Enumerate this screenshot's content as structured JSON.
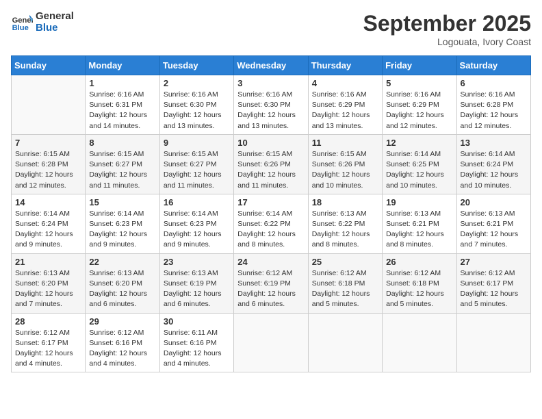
{
  "logo": {
    "line1": "General",
    "line2": "Blue"
  },
  "title": "September 2025",
  "location": "Logouata, Ivory Coast",
  "days_header": [
    "Sunday",
    "Monday",
    "Tuesday",
    "Wednesday",
    "Thursday",
    "Friday",
    "Saturday"
  ],
  "weeks": [
    [
      {
        "day": "",
        "info": ""
      },
      {
        "day": "1",
        "info": "Sunrise: 6:16 AM\nSunset: 6:31 PM\nDaylight: 12 hours\nand 14 minutes."
      },
      {
        "day": "2",
        "info": "Sunrise: 6:16 AM\nSunset: 6:30 PM\nDaylight: 12 hours\nand 13 minutes."
      },
      {
        "day": "3",
        "info": "Sunrise: 6:16 AM\nSunset: 6:30 PM\nDaylight: 12 hours\nand 13 minutes."
      },
      {
        "day": "4",
        "info": "Sunrise: 6:16 AM\nSunset: 6:29 PM\nDaylight: 12 hours\nand 13 minutes."
      },
      {
        "day": "5",
        "info": "Sunrise: 6:16 AM\nSunset: 6:29 PM\nDaylight: 12 hours\nand 12 minutes."
      },
      {
        "day": "6",
        "info": "Sunrise: 6:16 AM\nSunset: 6:28 PM\nDaylight: 12 hours\nand 12 minutes."
      }
    ],
    [
      {
        "day": "7",
        "info": "Sunrise: 6:15 AM\nSunset: 6:28 PM\nDaylight: 12 hours\nand 12 minutes."
      },
      {
        "day": "8",
        "info": "Sunrise: 6:15 AM\nSunset: 6:27 PM\nDaylight: 12 hours\nand 11 minutes."
      },
      {
        "day": "9",
        "info": "Sunrise: 6:15 AM\nSunset: 6:27 PM\nDaylight: 12 hours\nand 11 minutes."
      },
      {
        "day": "10",
        "info": "Sunrise: 6:15 AM\nSunset: 6:26 PM\nDaylight: 12 hours\nand 11 minutes."
      },
      {
        "day": "11",
        "info": "Sunrise: 6:15 AM\nSunset: 6:26 PM\nDaylight: 12 hours\nand 10 minutes."
      },
      {
        "day": "12",
        "info": "Sunrise: 6:14 AM\nSunset: 6:25 PM\nDaylight: 12 hours\nand 10 minutes."
      },
      {
        "day": "13",
        "info": "Sunrise: 6:14 AM\nSunset: 6:24 PM\nDaylight: 12 hours\nand 10 minutes."
      }
    ],
    [
      {
        "day": "14",
        "info": "Sunrise: 6:14 AM\nSunset: 6:24 PM\nDaylight: 12 hours\nand 9 minutes."
      },
      {
        "day": "15",
        "info": "Sunrise: 6:14 AM\nSunset: 6:23 PM\nDaylight: 12 hours\nand 9 minutes."
      },
      {
        "day": "16",
        "info": "Sunrise: 6:14 AM\nSunset: 6:23 PM\nDaylight: 12 hours\nand 9 minutes."
      },
      {
        "day": "17",
        "info": "Sunrise: 6:14 AM\nSunset: 6:22 PM\nDaylight: 12 hours\nand 8 minutes."
      },
      {
        "day": "18",
        "info": "Sunrise: 6:13 AM\nSunset: 6:22 PM\nDaylight: 12 hours\nand 8 minutes."
      },
      {
        "day": "19",
        "info": "Sunrise: 6:13 AM\nSunset: 6:21 PM\nDaylight: 12 hours\nand 8 minutes."
      },
      {
        "day": "20",
        "info": "Sunrise: 6:13 AM\nSunset: 6:21 PM\nDaylight: 12 hours\nand 7 minutes."
      }
    ],
    [
      {
        "day": "21",
        "info": "Sunrise: 6:13 AM\nSunset: 6:20 PM\nDaylight: 12 hours\nand 7 minutes."
      },
      {
        "day": "22",
        "info": "Sunrise: 6:13 AM\nSunset: 6:20 PM\nDaylight: 12 hours\nand 6 minutes."
      },
      {
        "day": "23",
        "info": "Sunrise: 6:13 AM\nSunset: 6:19 PM\nDaylight: 12 hours\nand 6 minutes."
      },
      {
        "day": "24",
        "info": "Sunrise: 6:12 AM\nSunset: 6:19 PM\nDaylight: 12 hours\nand 6 minutes."
      },
      {
        "day": "25",
        "info": "Sunrise: 6:12 AM\nSunset: 6:18 PM\nDaylight: 12 hours\nand 5 minutes."
      },
      {
        "day": "26",
        "info": "Sunrise: 6:12 AM\nSunset: 6:18 PM\nDaylight: 12 hours\nand 5 minutes."
      },
      {
        "day": "27",
        "info": "Sunrise: 6:12 AM\nSunset: 6:17 PM\nDaylight: 12 hours\nand 5 minutes."
      }
    ],
    [
      {
        "day": "28",
        "info": "Sunrise: 6:12 AM\nSunset: 6:17 PM\nDaylight: 12 hours\nand 4 minutes."
      },
      {
        "day": "29",
        "info": "Sunrise: 6:12 AM\nSunset: 6:16 PM\nDaylight: 12 hours\nand 4 minutes."
      },
      {
        "day": "30",
        "info": "Sunrise: 6:11 AM\nSunset: 6:16 PM\nDaylight: 12 hours\nand 4 minutes."
      },
      {
        "day": "",
        "info": ""
      },
      {
        "day": "",
        "info": ""
      },
      {
        "day": "",
        "info": ""
      },
      {
        "day": "",
        "info": ""
      }
    ]
  ]
}
